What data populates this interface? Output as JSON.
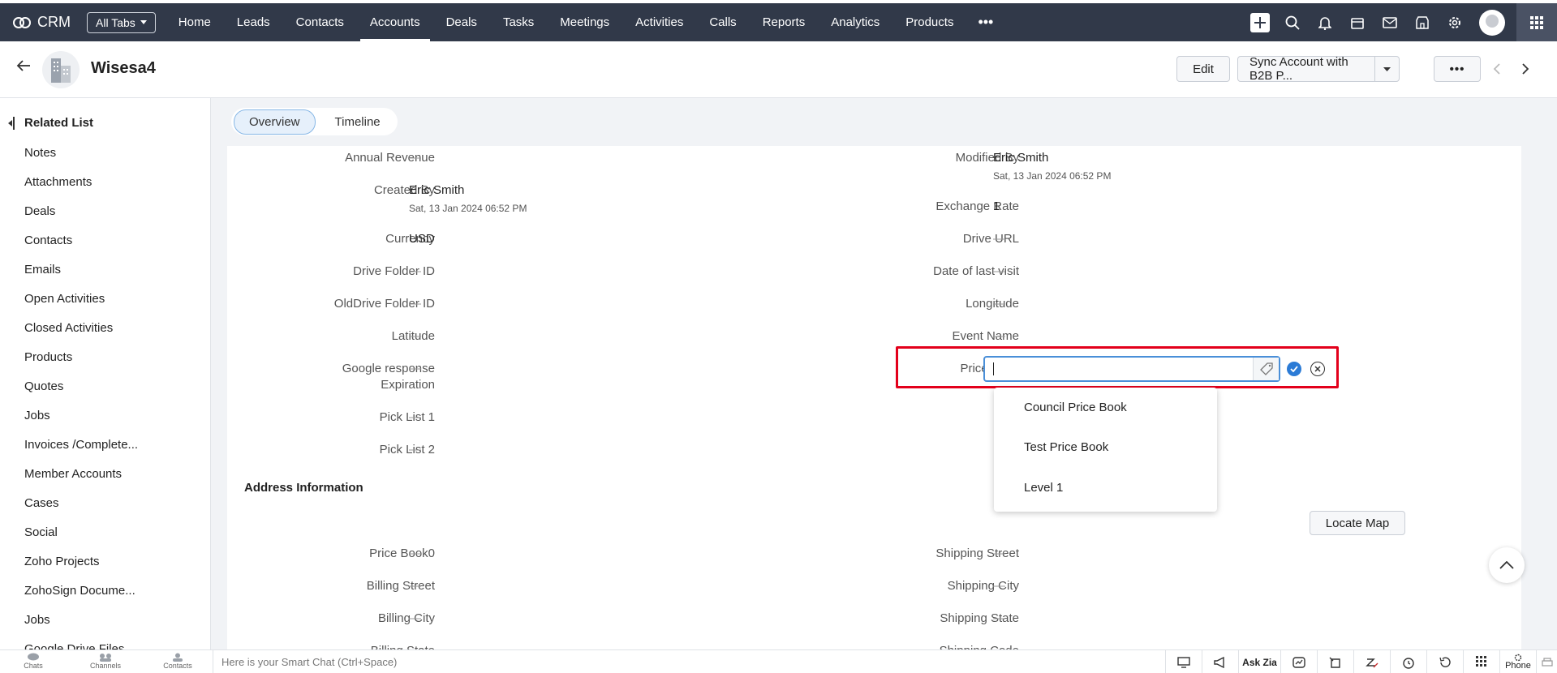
{
  "brand": {
    "name": "CRM"
  },
  "nav": {
    "all_tabs_label": "All Tabs",
    "tabs": [
      {
        "label": "Home"
      },
      {
        "label": "Leads"
      },
      {
        "label": "Contacts"
      },
      {
        "label": "Accounts",
        "active": true
      },
      {
        "label": "Deals"
      },
      {
        "label": "Tasks"
      },
      {
        "label": "Meetings"
      },
      {
        "label": "Activities"
      },
      {
        "label": "Calls"
      },
      {
        "label": "Reports"
      },
      {
        "label": "Analytics"
      },
      {
        "label": "Products"
      }
    ],
    "more_label": "•••"
  },
  "record": {
    "name": "Wisesa4",
    "edit_label": "Edit",
    "sync_label": "Sync Account with B2B P...",
    "more_label": "•••"
  },
  "sidebar": {
    "title": "Related List",
    "items": [
      "Notes",
      "Attachments",
      "Deals",
      "Contacts",
      "Emails",
      "Open Activities",
      "Closed Activities",
      "Products",
      "Quotes",
      "Jobs",
      "Invoices /Complete...",
      "Member Accounts",
      "Cases",
      "Social",
      "Zoho Projects",
      "ZohoSign Docume...",
      "Jobs",
      "Google Drive Files"
    ]
  },
  "tabs": {
    "overview": "Overview",
    "timeline": "Timeline"
  },
  "fields": {
    "annual_revenue": {
      "label": "Annual Revenue",
      "value": "—"
    },
    "created_by": {
      "label": "Created By",
      "value": "Eric Smith",
      "sub": "Sat, 13 Jan 2024 06:52 PM"
    },
    "currency": {
      "label": "Currency",
      "value": "USD"
    },
    "drive_folder_id": {
      "label": "Drive Folder ID",
      "value": "—"
    },
    "olddrive_folder_id": {
      "label": "OldDrive Folder ID",
      "value": "—"
    },
    "latitude": {
      "label": "Latitude",
      "value": "—"
    },
    "google_response": {
      "label": "Google response Expiration",
      "value": "—"
    },
    "pick_list_1": {
      "label": "Pick List 1",
      "value": "—"
    },
    "pick_list_2": {
      "label": "Pick List 2",
      "value": "—"
    },
    "modified_by": {
      "label": "Modified By",
      "value": "Eric Smith",
      "sub": "Sat, 13 Jan 2024 06:52 PM"
    },
    "exchange_rate": {
      "label": "Exchange Rate",
      "value": "1"
    },
    "drive_url": {
      "label": "Drive URL",
      "value": "—"
    },
    "date_last_visit": {
      "label": "Date of last visit",
      "value": "—"
    },
    "longitude": {
      "label": "Longitude",
      "value": "—"
    },
    "event_name": {
      "label": "Event Name",
      "value": "—"
    },
    "price_book": {
      "label": "Price Book",
      "value": ""
    }
  },
  "address": {
    "section_title": "Address Information",
    "locate_map_label": "Locate Map",
    "price_book0": {
      "label": "Price Book0",
      "value": "—"
    },
    "billing_street": {
      "label": "Billing Street",
      "value": "—"
    },
    "billing_city": {
      "label": "Billing City",
      "value": "—"
    },
    "billing_state": {
      "label": "Billing State",
      "value": "—"
    },
    "shipping_street": {
      "label": "Shipping Street",
      "value": "—"
    },
    "shipping_city": {
      "label": "Shipping City",
      "value": "—"
    },
    "shipping_state": {
      "label": "Shipping State",
      "value": "—"
    },
    "shipping_code": {
      "label": "Shipping Code",
      "value": "—"
    }
  },
  "price_book_dropdown": {
    "options": [
      "Council Price Book",
      "Test Price Book",
      "Level 1"
    ]
  },
  "bottom": {
    "chats": "Chats",
    "channels": "Channels",
    "contacts": "Contacts",
    "smart_chat_placeholder": "Here is your Smart Chat (Ctrl+Space)",
    "ask_zia": "Ask Zia",
    "phone": "Phone"
  },
  "colors": {
    "nav_bg": "#313949",
    "accent": "#2b7bd6",
    "highlight_border": "#e3001b"
  }
}
